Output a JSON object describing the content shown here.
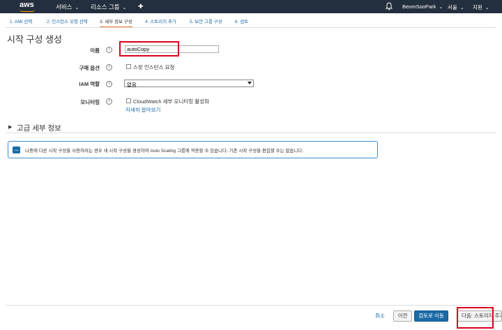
{
  "nav": {
    "logo": "aws",
    "services": "서비스",
    "resource_groups": "리소스 그룹",
    "username": "BeomSooPark",
    "region": "서울",
    "support": "지원"
  },
  "steps": [
    {
      "label": "1. AMI 선택"
    },
    {
      "label": "2. 인스턴스 유형 선택"
    },
    {
      "label": "3. 세부 정보 구성"
    },
    {
      "label": "4. 스토리지 추가"
    },
    {
      "label": "5. 보안 그룹 구성"
    },
    {
      "label": "6. 검토"
    }
  ],
  "page_title": "시작 구성 생성",
  "form": {
    "name_label": "이름",
    "name_value": "autoCopy",
    "purchase_label": "구매 옵션",
    "spot_label": "스팟 인스턴스 요청",
    "iam_label": "IAM 역할",
    "iam_value": "없음",
    "monitoring_label": "모니터링",
    "cloudwatch_label": "CloudWatch 세부 모니터링 활성화",
    "learn_more": "자세히 알아보기",
    "info_glyph": "i"
  },
  "advanced": {
    "title": "고급 세부 정보",
    "toggle_glyph": "▶"
  },
  "alert": {
    "text": "나중에 다른 시작 구성을 사용하려는 경우 새 시작 구성을 생성하여 Auto Scaling 그룹에 적용할 수 있습니다. 기존 시작 구성을 편집할 수는 없습니다.",
    "icon_glyph": "…"
  },
  "footer": {
    "cancel": "취소",
    "prev": "이전",
    "review": "검토로 이동",
    "next": "다음: 스토리지 추가"
  },
  "colors": {
    "nav_bg": "#232f3e",
    "accent_orange": "#e7782b",
    "link_blue": "#1a6aa5",
    "highlight_red": "#d9001b"
  }
}
